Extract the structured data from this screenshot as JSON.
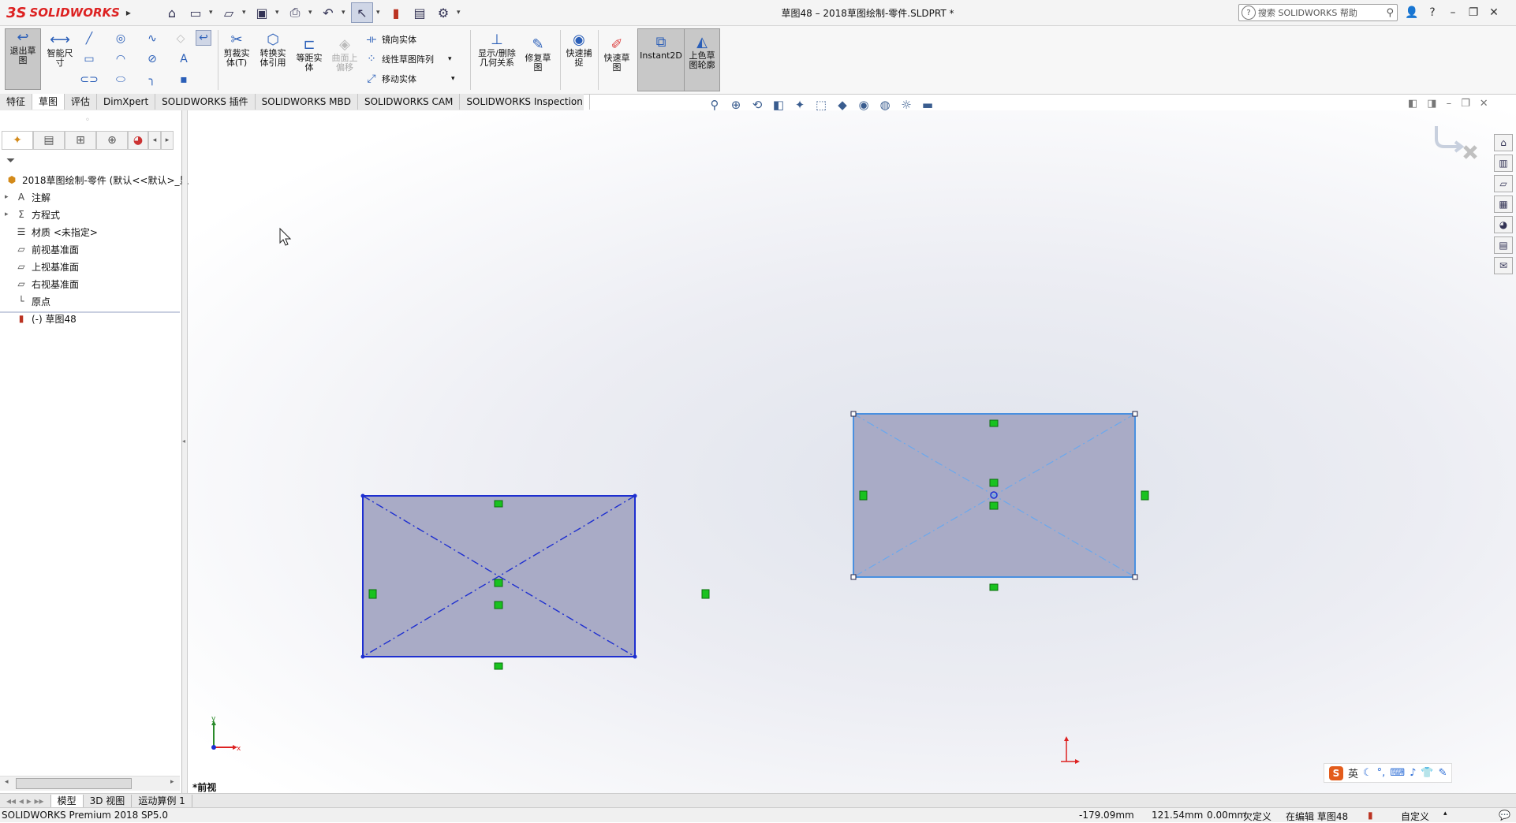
{
  "app": {
    "brand": "SOLIDWORKS",
    "brand_mark": "3S",
    "window_title": "草图48 – 2018草图绘制-零件.SLDPRT *",
    "help_search_placeholder": "搜索 SOLIDWORKS 帮助"
  },
  "quick_access": [
    "home-icon",
    "new-icon",
    "open-icon",
    "save-icon",
    "print-icon",
    "undo-icon",
    "select-icon",
    "rebuild-icon",
    "file-props-icon",
    "options-icon"
  ],
  "ribbon": {
    "exit_sketch": "退出草图",
    "smart_dim": "智能尺寸",
    "trim": "剪裁实体(T)",
    "convert": "转换实体引用",
    "offset": "等距实体",
    "offset_surface": "曲面上偏移",
    "mirror": "镜向实体",
    "linear_pattern": "线性草图阵列",
    "move": "移动实体",
    "show_relations": "显示/删除几何关系",
    "repair": "修复草图",
    "quick_snap": "快速捕捉",
    "rapid_sketch": "快速草图",
    "instant2d": "Instant2D",
    "shaded_contours": "上色草图轮廓"
  },
  "tabs": [
    "特征",
    "草图",
    "评估",
    "DimXpert",
    "SOLIDWORKS 插件",
    "SOLIDWORKS MBD",
    "SOLIDWORKS CAM",
    "SOLIDWORKS Inspection"
  ],
  "active_tab": "草图",
  "tree": {
    "root": "2018草图绘制-零件  (默认<<默认>_显",
    "items": [
      {
        "label": "注解",
        "icon": "annotation-icon",
        "expand": "▸"
      },
      {
        "label": "方程式",
        "icon": "equation-icon",
        "expand": "▸"
      },
      {
        "label": "材质 <未指定>",
        "icon": "material-icon",
        "expand": ""
      },
      {
        "label": "前视基准面",
        "icon": "plane-icon",
        "expand": ""
      },
      {
        "label": "上视基准面",
        "icon": "plane-icon",
        "expand": ""
      },
      {
        "label": "右视基准面",
        "icon": "plane-icon",
        "expand": ""
      },
      {
        "label": "原点",
        "icon": "origin-icon",
        "expand": ""
      },
      {
        "label": "(-) 草图48",
        "icon": "sketch-icon",
        "expand": ""
      }
    ]
  },
  "viewport": {
    "view_name": "*前视",
    "triad_x": "x",
    "triad_y": "y"
  },
  "bottom_tabs": [
    "模型",
    "3D 视图",
    "运动算例 1"
  ],
  "status": {
    "product": "SOLIDWORKS Premium 2018 SP5.0",
    "x": "-179.09mm",
    "y": "121.54mm",
    "z": "0.00mm",
    "defined": "欠定义",
    "editing": "在编辑 草图48",
    "units": "自定义"
  },
  "ime": {
    "logo": "S",
    "lang": "英"
  },
  "colors": {
    "sketch_fill": "#a9abc6",
    "sketch_line_active": "#1e2fd0",
    "sketch_line_selected": "#4a90e0",
    "relation_green": "#19c21f"
  }
}
